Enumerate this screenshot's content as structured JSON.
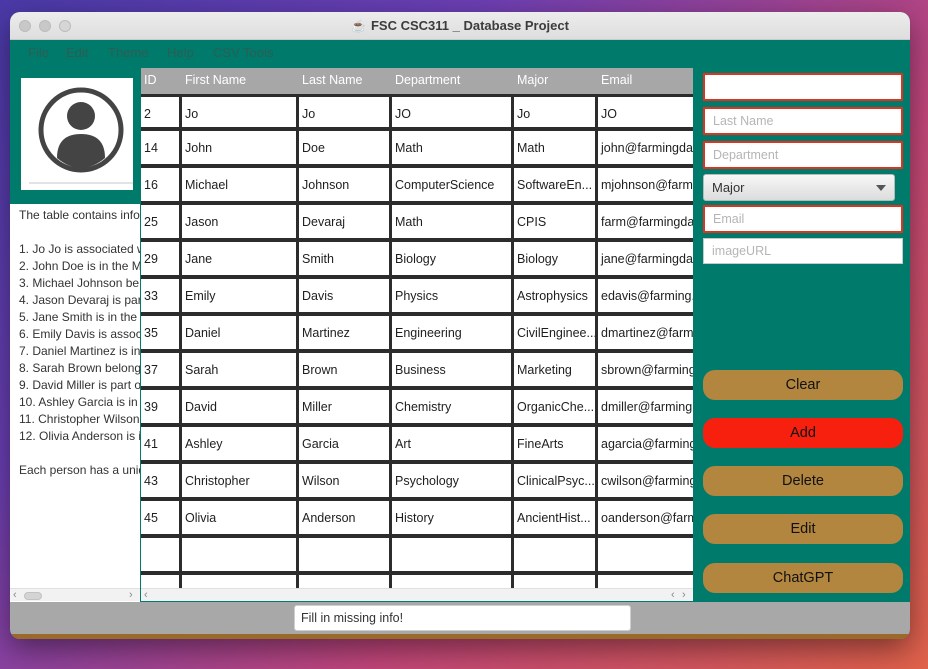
{
  "window": {
    "title": "FSC CSC311 _ Database Project"
  },
  "menu": [
    "File",
    "Edit",
    "Theme",
    "Help",
    "CSV Tools"
  ],
  "description": [
    "The table contains info",
    "",
    "1. Jo Jo is associated w",
    "2. John Doe is in the M",
    "3. Michael Johnson be",
    "4. Jason Devaraj is par",
    "5. Jane Smith is in the",
    "6. Emily Davis is assoc",
    "7. Daniel Martinez is in",
    "8. Sarah Brown belong",
    "9. David Miller is part o",
    "10. Ashley Garcia is in",
    "11. Christopher Wilson",
    "12. Olivia Anderson is i",
    "",
    "Each person has a uniq"
  ],
  "table": {
    "columns": [
      "ID",
      "First Name",
      "Last Name",
      "Department",
      "Major",
      "Email"
    ],
    "rows": [
      [
        "2",
        "Jo",
        "Jo",
        "JO",
        "Jo",
        "JO"
      ],
      [
        "14",
        "John",
        "Doe",
        "Math",
        "Math",
        "john@farmingda"
      ],
      [
        "16",
        "Michael",
        "Johnson",
        "ComputerScience",
        "SoftwareEn...",
        "mjohnson@farm"
      ],
      [
        "25",
        "Jason",
        "Devaraj",
        "Math",
        "CPIS",
        "farm@farmingda"
      ],
      [
        "29",
        "Jane",
        "Smith",
        "Biology",
        "Biology",
        "jane@farmingda"
      ],
      [
        "33",
        "Emily",
        "Davis",
        "Physics",
        "Astrophysics",
        "edavis@farming."
      ],
      [
        "35",
        "Daniel",
        "Martinez",
        "Engineering",
        "CivilEnginee...",
        "dmartinez@farm"
      ],
      [
        "37",
        "Sarah",
        "Brown",
        "Business",
        "Marketing",
        "sbrown@farming"
      ],
      [
        "39",
        "David",
        "Miller",
        "Chemistry",
        "OrganicChe...",
        "dmiller@farming"
      ],
      [
        "41",
        "Ashley",
        "Garcia",
        "Art",
        "FineArts",
        "agarcia@farming"
      ],
      [
        "43",
        "Christopher",
        "Wilson",
        "Psychology",
        "ClinicalPsyc...",
        "cwilson@farming"
      ],
      [
        "45",
        "Olivia",
        "Anderson",
        "History",
        "AncientHist...",
        "oanderson@farm"
      ],
      [
        "",
        "",
        "",
        "",
        "",
        ""
      ],
      [
        "",
        "",
        "",
        "",
        "",
        ""
      ]
    ]
  },
  "form": {
    "first_name_value": "",
    "last_name_placeholder": "Last Name",
    "department_placeholder": "Department",
    "major_selected": "Major",
    "email_placeholder": "Email",
    "image_url_placeholder": "imageURL"
  },
  "buttons": {
    "clear": "Clear",
    "add": "Add",
    "delete": "Delete",
    "edit": "Edit",
    "chatgpt": "ChatGPT"
  },
  "status": {
    "message": "Fill in missing info!"
  },
  "colors": {
    "teal": "#007a6a",
    "button": "#b3863f",
    "add_button": "#f7200f",
    "error_border": "#e0331f"
  }
}
